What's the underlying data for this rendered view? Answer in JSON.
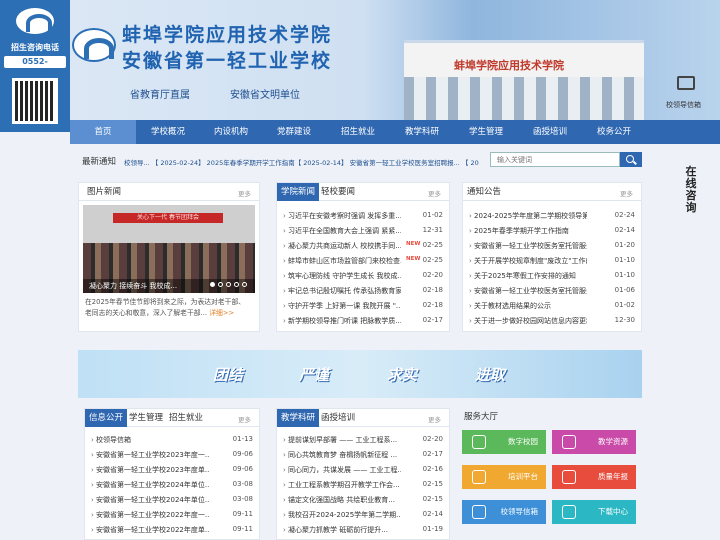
{
  "left": {
    "hotline_label": "招生咨询电话",
    "phone": "0552-4125313"
  },
  "banner": {
    "title1": "蚌埠学院应用技术学院",
    "title2": "安徽省第一轻工业学校",
    "sub1": "省教育厅直属",
    "sub2": "安徽省文明单位",
    "building_sign": "蚌埠学院应用技术学院",
    "mail_label": "校领导信箱"
  },
  "nav": [
    "首页",
    "学校概况",
    "内设机构",
    "党群建设",
    "招生就业",
    "教学科研",
    "学生管理",
    "函授培训",
    "校务公开"
  ],
  "notice": {
    "label": "最新通知",
    "ticker": "校领导... 【 2025-02-24】    2025年春季学期开学工作指南【 2025-02-14】    安徽省第一轻工业学校医务室招聘报... 【 20",
    "search_placeholder": "输入关键词"
  },
  "float_label": "在线咨询",
  "more": "更多",
  "picnews": {
    "title": "图片新闻",
    "caption": "凝心聚力 接续奋斗 我校成...",
    "photo_banner": "关心下一代 春节团拜会",
    "desc": "在2025年春节佳节即将到来之际，为表达对老干部、老同志的关心和敬意，深入了解老干部...",
    "desc_more": "详细>>"
  },
  "college": {
    "tabs": [
      "学院新闻",
      "轻校要闻"
    ],
    "rows": [
      {
        "t": "习近平在安徽考察时强调 发挥多重...",
        "d": "01-02",
        "new": false
      },
      {
        "t": "习近平在全国教育大会上强调 紧紧...",
        "d": "12-31",
        "new": false
      },
      {
        "t": "凝心聚力共商运动新人 校校携手同...",
        "d": "02-25",
        "new": true
      },
      {
        "t": "蚌埠市蚌山区市场监管部门来校检查...",
        "d": "02-25",
        "new": true
      },
      {
        "t": "筑牢心理防线 守护学生成长 我校成...",
        "d": "02-20",
        "new": false
      },
      {
        "t": "牢记总书记殷切嘱托 传承弘扬教育家...",
        "d": "02-18",
        "new": false
      },
      {
        "t": "守护开学季 上好第一课 我院开展 \"...",
        "d": "02-18",
        "new": false
      },
      {
        "t": "新学期校领导推门听课 把脉教学质...",
        "d": "02-17",
        "new": false
      }
    ]
  },
  "notices": {
    "title": "通知公告",
    "rows": [
      {
        "t": "2024-2025学年度第二学期校领导第二...",
        "d": "02-24"
      },
      {
        "t": "2025年春季学期开学工作指南",
        "d": "02-14"
      },
      {
        "t": "安徽省第一轻工业学校医务室托管服务项...",
        "d": "01-20"
      },
      {
        "t": "关于开展学校规章制度\"废改立\"工作的...",
        "d": "01-10"
      },
      {
        "t": "关于2025年寒假工作安排的通知",
        "d": "01-10"
      },
      {
        "t": "安徽省第一轻工业学校医务室托管服务项...",
        "d": "01-06"
      },
      {
        "t": "关于教材选用结果的公示",
        "d": "01-02"
      },
      {
        "t": "关于进一步做好校园网站信息内容更新维...",
        "d": "12-30"
      }
    ]
  },
  "slogan": [
    "团结",
    "严谨",
    "求实",
    "进取"
  ],
  "info": {
    "tabs": [
      "信息公开",
      "学生管理",
      "招生就业"
    ],
    "rows": [
      {
        "t": "校领导信箱",
        "d": "01-13"
      },
      {
        "t": "安徽省第一轻工业学校2023年度一...",
        "d": "09-06"
      },
      {
        "t": "安徽省第一轻工业学校2023年度单...",
        "d": "09-06"
      },
      {
        "t": "安徽省第一轻工业学校2024年单位...",
        "d": "03-08"
      },
      {
        "t": "安徽省第一轻工业学校2024年单位...",
        "d": "03-08"
      },
      {
        "t": "安徽省第一轻工业学校2022年度一...",
        "d": "09-11"
      },
      {
        "t": "安徽省第一轻工业学校2022年度单...",
        "d": "09-11"
      }
    ]
  },
  "teach": {
    "tabs": [
      "教学科研",
      "函授培训"
    ],
    "rows": [
      {
        "t": "提前谋划早部署 —— 工业工程系...",
        "d": "02-20"
      },
      {
        "t": "同心共筑教育梦 奋楫扬帆新征程 ...",
        "d": "02-17"
      },
      {
        "t": "同心同力，共谋发展 —— 工业工程...",
        "d": "02-16"
      },
      {
        "t": "工业工程系教学期召开教学工作会...",
        "d": "02-15"
      },
      {
        "t": "锚定文化强国战略 共绘职业教育...",
        "d": "02-15"
      },
      {
        "t": "我校召开2024-2025学年第二学期...",
        "d": "02-14"
      },
      {
        "t": "凝心聚力抓教学 砥砺前行提升...",
        "d": "01-19"
      }
    ]
  },
  "services": {
    "title": "服务大厅",
    "items": [
      {
        "label": "数字校园",
        "color": "#5bb85b"
      },
      {
        "label": "教学资源",
        "color": "#c94aa8"
      },
      {
        "label": "培训平台",
        "color": "#f0a830"
      },
      {
        "label": "质量年报",
        "color": "#e74c3c"
      },
      {
        "label": "校领导信箱",
        "color": "#3d8fd8"
      },
      {
        "label": "下载中心",
        "color": "#2bb7c4"
      }
    ]
  }
}
